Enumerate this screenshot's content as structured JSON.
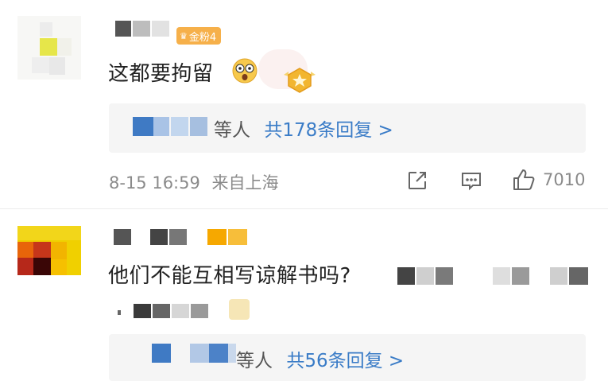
{
  "comments": [
    {
      "text": "这都要拘留",
      "badge_label": "金粉4",
      "reply_summary": {
        "who_suffix": "等人",
        "link": "共178条回复 >"
      },
      "timestamp": "8-15 16:59",
      "location": "来自上海",
      "like_count": "7010",
      "emoji": "shocked-face-emoji"
    },
    {
      "text": "他们不能互相写谅解书吗?",
      "reply_summary": {
        "who_suffix": "等人",
        "link": "共56条回复 >"
      }
    }
  ],
  "colors": {
    "link_blue": "#3a7cc7",
    "reply_bg": "#f5f5f5",
    "badge_orange": "#f6b04a",
    "meta_gray": "#8a8a8a"
  },
  "icons": [
    "share-icon",
    "comment-icon",
    "like-icon"
  ]
}
